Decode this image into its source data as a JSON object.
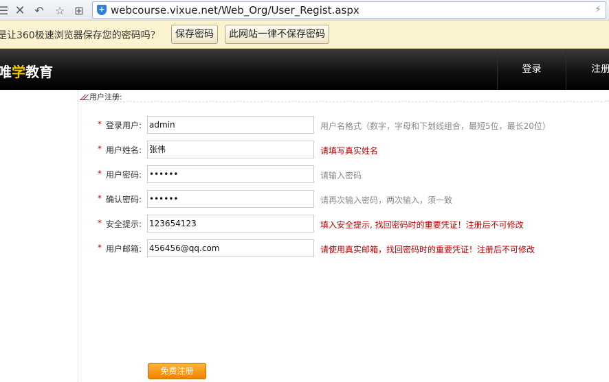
{
  "browser": {
    "address": "webcourse.vixue.net/Web_Org/User_Regist.aspx"
  },
  "password_bar": {
    "prompt": "是让360极速浏览器保存您的密码吗？",
    "save_label": "保存密码",
    "never_label": "此网站一律不保存密码"
  },
  "header": {
    "logo_pre": "唯",
    "logo_hl": "学",
    "logo_post": "教育",
    "nav": [
      "登录",
      "注册"
    ]
  },
  "form": {
    "section_title": "用户注册:",
    "required_mark": "*",
    "fields": [
      {
        "label": "登录用户:",
        "value": "admin",
        "hint": "用户名格式（数字，字母和下划线组合，最短5位，最长20位）"
      },
      {
        "label": "用户姓名:",
        "value": "张伟",
        "hint": "请填写真实姓名"
      },
      {
        "label": "用户密码:",
        "value": "••••••",
        "hint": "请输入密码"
      },
      {
        "label": "确认密码:",
        "value": "••••••",
        "hint": "请再次输入密码，两次输入，须一致"
      },
      {
        "label": "安全提示:",
        "value": "123654123",
        "hint": "填入安全提示, 找回密码时的重要凭证！注册后不可修改"
      },
      {
        "label": "用户邮箱:",
        "value": "456456@qq.com",
        "hint": "请使用真实邮箱，找回密码时的重要凭证！注册后不可修改"
      }
    ],
    "submit_label": "免费注册"
  },
  "colors": {
    "hint_red": "#c00000",
    "accent_orange": "#f08400",
    "logo_yellow": "#f3c400"
  }
}
